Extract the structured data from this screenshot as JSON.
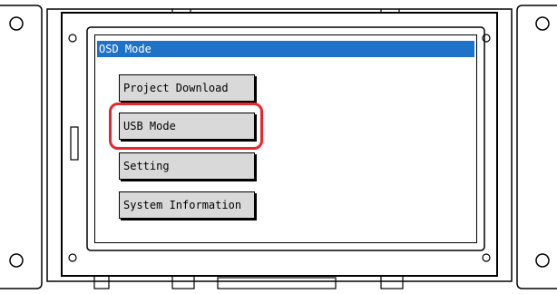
{
  "osd": {
    "title": "OSD Mode"
  },
  "menu": {
    "items": [
      {
        "label": "Project Download"
      },
      {
        "label": "USB Mode"
      },
      {
        "label": "Setting"
      },
      {
        "label": "System Information"
      }
    ],
    "highlighted_item": "USB Mode"
  },
  "colors": {
    "titlebar": "#1e72c8",
    "button_fill": "#d9d9d9",
    "highlight": "#e8262b"
  }
}
